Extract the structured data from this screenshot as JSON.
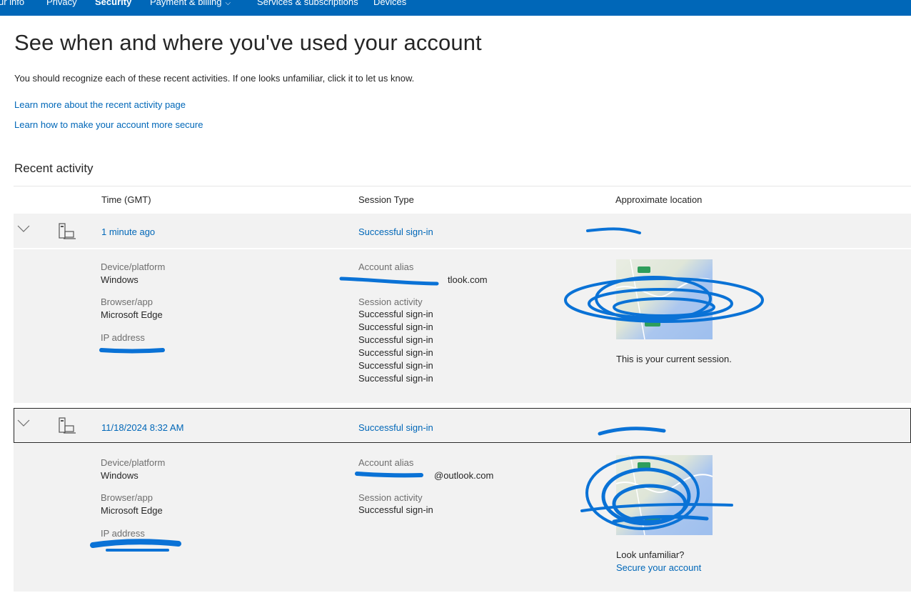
{
  "nav": {
    "items": [
      "ur info",
      "Privacy",
      "Security",
      "Payment & billing",
      "Services & subscriptions",
      "Devices"
    ],
    "active": "Security"
  },
  "page": {
    "title": "See when and where you've used your account",
    "intro": "You should recognize each of these recent activities. If one looks unfamiliar, click it to let us know.",
    "link_learn_activity": "Learn more about the recent activity page",
    "link_secure": "Learn how to make your account more secure",
    "section_title": "Recent activity"
  },
  "table": {
    "headers": {
      "time": "Time (GMT)",
      "session": "Session Type",
      "location": "Approximate location"
    },
    "labels": {
      "device": "Device/platform",
      "browser": "Browser/app",
      "ip": "IP address",
      "alias": "Account alias",
      "session_activity": "Session activity"
    },
    "rows": [
      {
        "time": "1 minute ago",
        "session_type": "Successful sign-in",
        "device": "Windows",
        "browser": "Microsoft Edge",
        "alias_visible": "tlook.com",
        "activities": [
          "Successful sign-in",
          "Successful sign-in",
          "Successful sign-in",
          "Successful sign-in",
          "Successful sign-in",
          "Successful sign-in"
        ],
        "note": "This is your current session."
      },
      {
        "time": "11/18/2024 8:32 AM",
        "session_type": "Successful sign-in",
        "device": "Windows",
        "browser": "Microsoft Edge",
        "alias_visible": "@outlook.com",
        "activities": [
          "Successful sign-in"
        ],
        "note": "Look unfamiliar?",
        "note_link": "Secure your account"
      }
    ]
  },
  "colors": {
    "nav_bg": "#0067b8",
    "link": "#0067b8",
    "row_bg": "#f2f2f2",
    "redaction": "#0a72d6"
  }
}
